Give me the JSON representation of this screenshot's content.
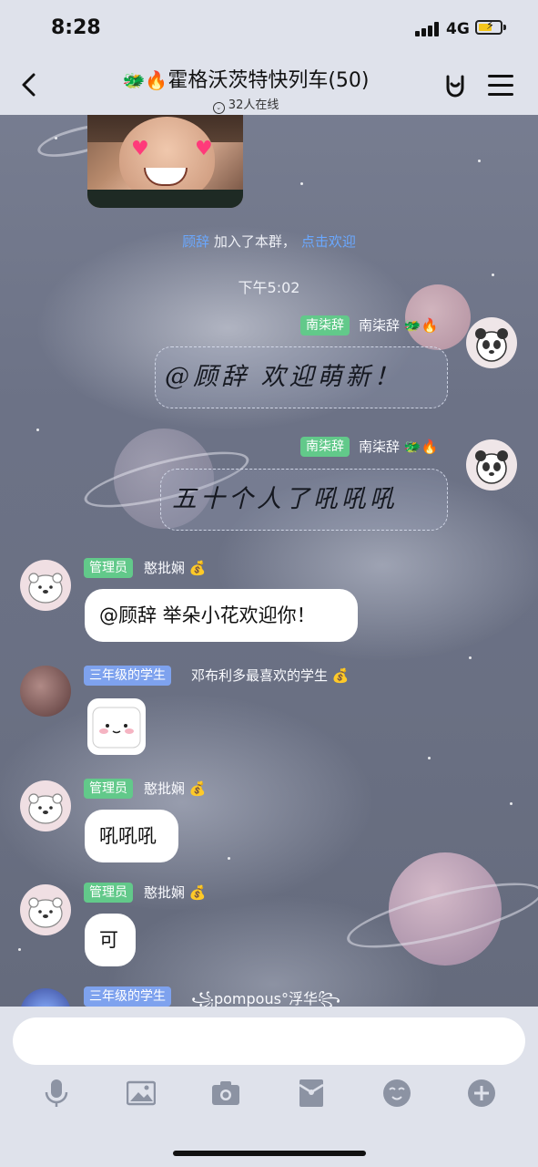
{
  "status_bar": {
    "time": "8:28",
    "network": "4G"
  },
  "header": {
    "emoji": "🐲🔥",
    "title": "霍格沃茨特快列车(50)",
    "online": "32人在线"
  },
  "chat": {
    "system_join": {
      "name": "顾辞",
      "text": "加入了本群，",
      "action": "点击欢迎"
    },
    "timestamp": "下午5:02",
    "messages": [
      {
        "tag": "南柒辞",
        "sender": "南柒辞 🐲🔥",
        "text": "@顾辞 欢迎萌新！"
      },
      {
        "tag": "南柒辞",
        "sender": "南柒辞 🐲🔥",
        "text": "五十个人了吼吼吼"
      },
      {
        "tag": "管理员",
        "sender": "憨批娴 💰",
        "text": "@顾辞 举朵小花欢迎你！"
      },
      {
        "tag": "三年级的学生",
        "sender": "邓布利多最喜欢的学生 💰",
        "text": ""
      },
      {
        "tag": "管理员",
        "sender": "憨批娴 💰",
        "text": "吼吼吼"
      },
      {
        "tag": "管理员",
        "sender": "憨批娴 💰",
        "text": "可"
      },
      {
        "tag": "三年级的学生",
        "sender": "꧁pompous°浮华꧂",
        "text": ""
      }
    ]
  },
  "input": {
    "value": "",
    "placeholder": ""
  },
  "toolbar": [
    "mic-icon",
    "image-icon",
    "camera-icon",
    "red-packet-icon",
    "emoji-icon",
    "plus-icon"
  ],
  "colors": {
    "tag_green": "#62c98a",
    "tag_blue": "#7ea2ee",
    "link_blue": "#6aa8ff",
    "bar_bg": "#dfe2eb"
  }
}
